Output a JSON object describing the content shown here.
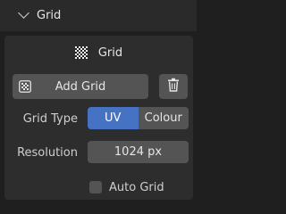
{
  "panel": {
    "title": "Grid"
  },
  "subheader": {
    "title": "Grid",
    "icon": "checker-grid-icon"
  },
  "add_grid": {
    "label": "Add Grid",
    "icon": "grid-texture-icon"
  },
  "delete": {
    "icon": "trash-icon"
  },
  "grid_type": {
    "label": "Grid Type",
    "options": [
      "UV",
      "Colour"
    ],
    "selected": "UV"
  },
  "resolution": {
    "label": "Resolution",
    "value": "1024 px"
  },
  "auto_grid": {
    "label": "Auto Grid",
    "checked": false
  },
  "colors": {
    "accent": "#4672c4",
    "button": "#545454",
    "panel": "#2d2d2d",
    "header": "#2a2a2a",
    "background": "#1f1f1f"
  }
}
